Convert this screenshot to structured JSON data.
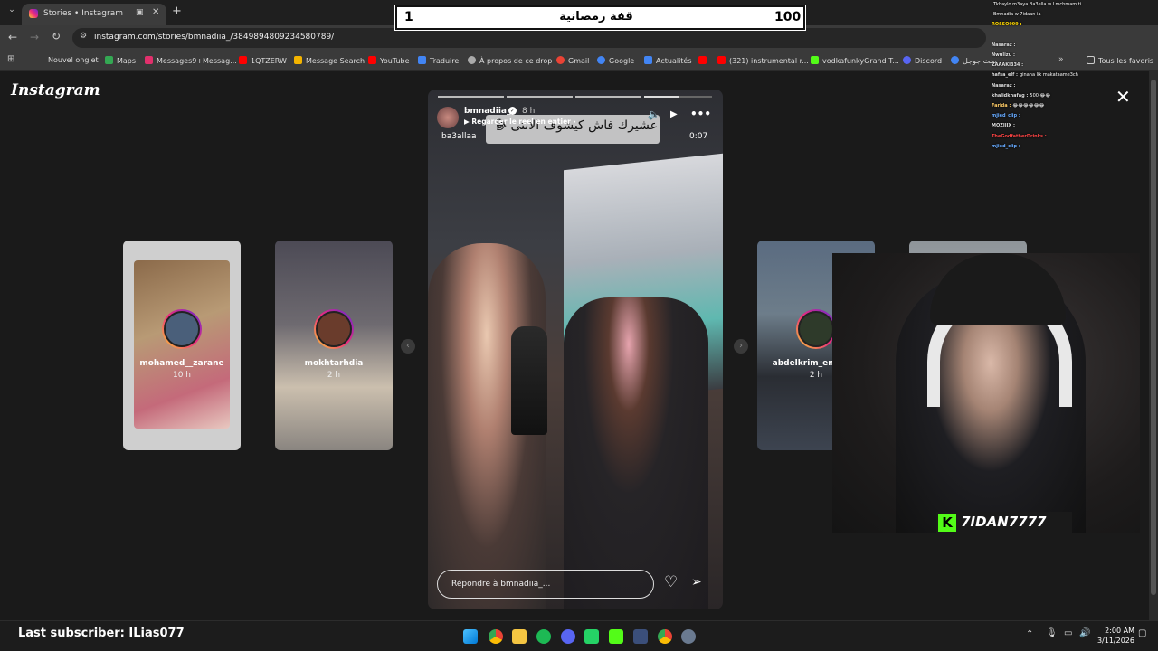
{
  "browser": {
    "tab_title": "Stories • Instagram",
    "url": "instagram.com/stories/bmnadiia_/3849894809234580789/",
    "bookmarks": [
      {
        "label": "Nouvel onglet",
        "color": "#888888"
      },
      {
        "label": "Maps",
        "color": "#34a853"
      },
      {
        "label": "Messages9+Messag...",
        "color": "#e1306c"
      },
      {
        "label": "1QTZERW",
        "color": "#ff0000"
      },
      {
        "label": "Message Search",
        "color": "#f4b400"
      },
      {
        "label": "YouTube",
        "color": "#ff0000"
      },
      {
        "label": "Traduire",
        "color": "#4285f4"
      },
      {
        "label": "À propos de ce drop",
        "color": "#aaaaaa"
      },
      {
        "label": "Gmail",
        "color": "#ea4335"
      },
      {
        "label": "Google",
        "color": "#4285f4"
      },
      {
        "label": "Actualités",
        "color": "#4285f4"
      },
      {
        "label": "",
        "color": "#ff0000"
      },
      {
        "label": "(321) instrumental r...",
        "color": "#ff0000"
      },
      {
        "label": "vodkafunkyGrand T...",
        "color": "#53fc18"
      },
      {
        "label": "Discord",
        "color": "#5865f2"
      },
      {
        "label": "بحث جوجل",
        "color": "#4285f4"
      }
    ],
    "all_bookmarks_label": "Tous les favoris"
  },
  "overlay": {
    "counter_left": "1",
    "title": "قفة رمضانية",
    "counter_right": "100"
  },
  "instagram": {
    "logo": "Instagram",
    "close_icon": "close-icon",
    "story": {
      "username": "bmnadiia_",
      "time_ago": "8 h",
      "watch_reel_label": "Regarder le reel en entier",
      "audio_label": "ba3allaa",
      "duration": "0:07",
      "caption": "عشيرك فاش كيشوف الانثى 😂",
      "reply_placeholder": "Répondre à bmnadiia_...",
      "progress_segments": 4,
      "progress_active": 3
    },
    "side_stories": [
      {
        "name": "mohamed__zarane",
        "time": "10 h"
      },
      {
        "name": "mokhtarhdia",
        "time": "2 h"
      },
      {
        "name": "abdelkrim_ennadifi",
        "time": "2 h"
      }
    ]
  },
  "stream": {
    "last_subscriber": "Last subscriber: ILias077",
    "streamer_tag": "7IDAN7777",
    "chat": [
      {
        "user": "",
        "msg": "Tkhaylo m3aya Ba3ella w Lmchmam ti",
        "color": "#ff4444"
      },
      {
        "user": "",
        "msg": "Bmnadia w 7idaan ia",
        "color": "#ffffff"
      },
      {
        "user": "ROSSO999 :",
        "msg": "",
        "color": "#ffd700"
      },
      {
        "user": "",
        "msg": "",
        "color": "#ffffff"
      },
      {
        "user": "Nasaraz :",
        "msg": "",
        "color": "#dddddd"
      },
      {
        "user": "Nwulizu :",
        "msg": "",
        "color": "#dddddd"
      },
      {
        "user": "ZAAAKI334 :",
        "msg": "",
        "color": "#dddddd"
      },
      {
        "user": "hafsa_elf :",
        "msg": "ginaha lik makataame3ch",
        "color": "#dddddd"
      },
      {
        "user": "Nasaraz :",
        "msg": "",
        "color": "#dddddd"
      },
      {
        "user": "khalidkhafag :",
        "msg": "500 😂😂",
        "color": "#dddddd"
      },
      {
        "user": "Farida :",
        "msg": "😂😂😂😂😂😂",
        "color": "#ffcc66"
      },
      {
        "user": "mjied_clip :",
        "msg": "",
        "color": "#66aaff"
      },
      {
        "user": "MOZIIIX :",
        "msg": "",
        "color": "#dddddd"
      },
      {
        "user": "TheGodfatherDrinks :",
        "msg": "",
        "color": "#ff4444"
      },
      {
        "user": "mjied_clip :",
        "msg": "",
        "color": "#66aaff"
      }
    ]
  },
  "system": {
    "time": "2:00 AM",
    "date": "3/11/2026"
  }
}
